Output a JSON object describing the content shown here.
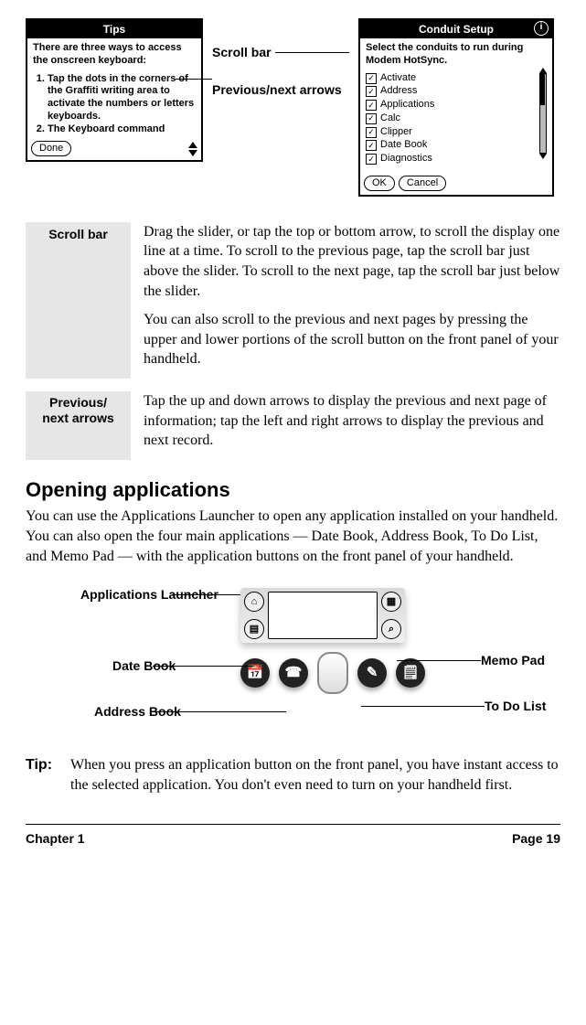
{
  "tips_palm": {
    "title": "Tips",
    "intro": "There are three ways to access the onscreen keyboard:",
    "items": [
      "Tap the dots in the corners of the Graffiti writing area to activate the numbers or letters keyboards.",
      "The Keyboard command"
    ],
    "done": "Done"
  },
  "conduit_palm": {
    "title": "Conduit Setup",
    "intro": "Select the conduits to run during Modem HotSync.",
    "items": [
      "Activate",
      "Address",
      "Applications",
      "Calc",
      "Clipper",
      "Date Book",
      "Diagnostics"
    ],
    "ok": "OK",
    "cancel": "Cancel"
  },
  "fig1_labels": {
    "scroll_bar": "Scroll bar",
    "prev_next": "Previous/next arrows"
  },
  "defs": {
    "scroll_bar_term": "Scroll bar",
    "scroll_bar_p1": "Drag the slider, or tap the top or bottom arrow, to scroll the display one line at a time. To scroll to the previous page, tap the scroll bar just above the slider. To scroll to the next page, tap the scroll bar just below the slider.",
    "scroll_bar_p2": "You can also scroll to the previous and next pages by pressing the upper and lower portions of the scroll button on the front panel of your handheld.",
    "prev_term_l1": "Previous/",
    "prev_term_l2": "next arrows",
    "prev_body": "Tap the up and down arrows to display the previous and next page of information; tap the left and right arrows to display the previous and next record."
  },
  "heading": "Opening applications",
  "intro": "You can use the Applications Launcher to open any application installed on your handheld. You can also open the four main applications — Date Book, Address Book, To Do List, and Memo Pad — with the application buttons on the front panel of your handheld.",
  "dev_callouts": {
    "apps_launcher": "Applications Launcher",
    "date_book": "Date Book",
    "address_book": "Address Book",
    "memo_pad": "Memo Pad",
    "todo_list": "To Do List"
  },
  "tip_label": "Tip:",
  "tip_body": "When you press an application button on the front panel, you have instant access to the selected application. You don't even need to turn on your handheld first.",
  "footer": {
    "chapter": "Chapter 1",
    "page": "Page 19"
  }
}
